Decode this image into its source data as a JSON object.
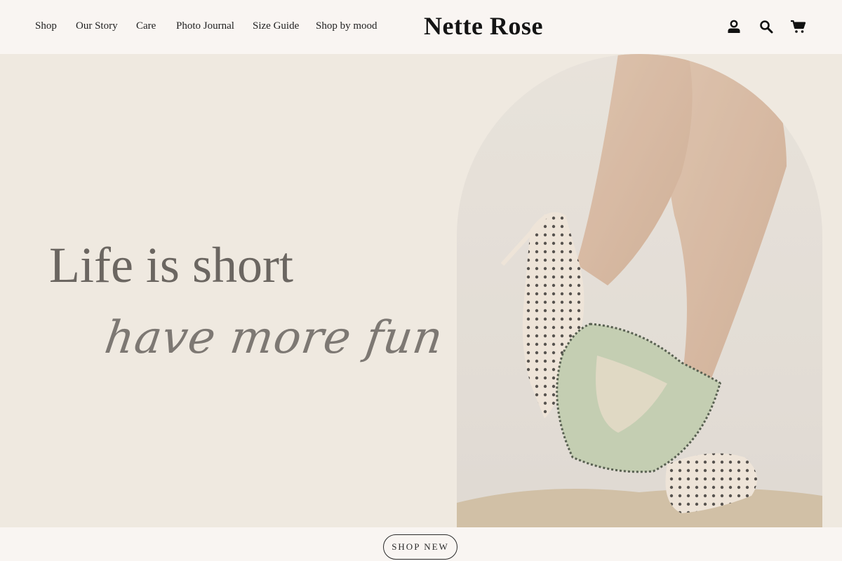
{
  "header": {
    "brand": "Nette Rose",
    "nav": [
      "Shop",
      "Our Story",
      "Care",
      "Photo Journal",
      "Size Guide",
      "Shop by mood"
    ],
    "icons": [
      "account-icon",
      "search-icon",
      "cart-icon"
    ]
  },
  "hero": {
    "headline": "Life is short",
    "script_line": "have more fun",
    "image_description_icon": "model-legs-polka-dot-heels"
  },
  "cta": {
    "label": "SHOP NEW"
  },
  "colors": {
    "page_bg": "#f9f5f2",
    "hero_bg": "#efe9e0",
    "headline": "#6b6661",
    "text": "#1c1c1c"
  }
}
